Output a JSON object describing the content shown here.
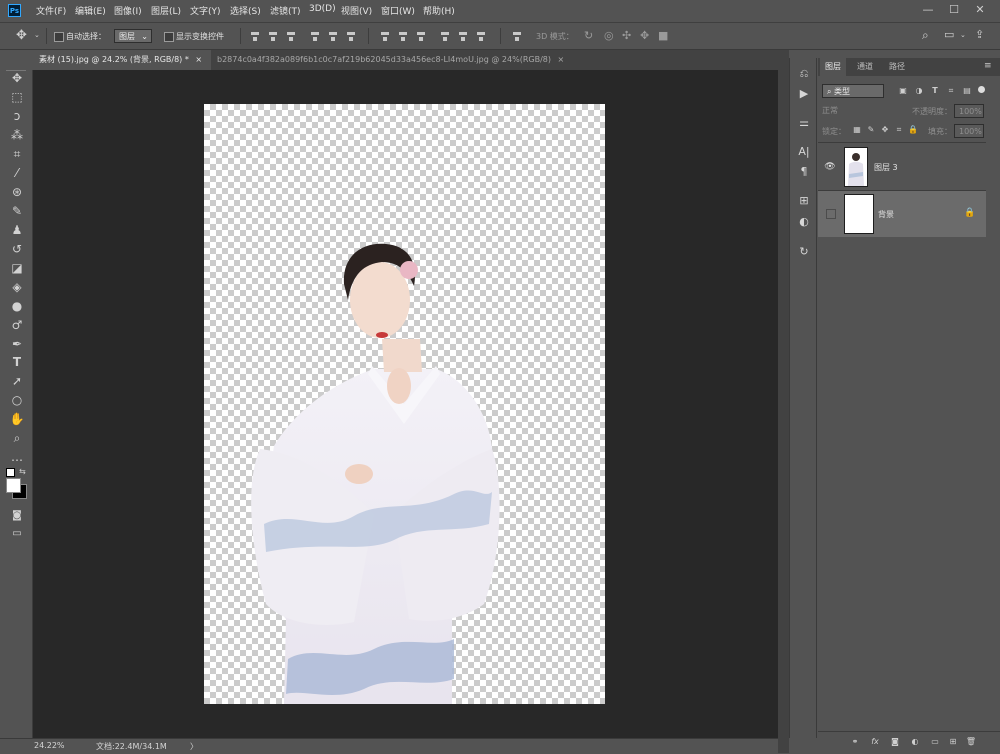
{
  "menubar": {
    "logo": "Ps",
    "items": [
      "文件(F)",
      "编辑(E)",
      "图像(I)",
      "图层(L)",
      "文字(Y)",
      "选择(S)",
      "滤镜(T)",
      "3D(D)",
      "视图(V)",
      "窗口(W)",
      "帮助(H)"
    ],
    "window_controls": [
      "—",
      "☐",
      "✕"
    ]
  },
  "options": {
    "auto_select_label": "自动选择：",
    "auto_select_value": "图层",
    "show_transform_label": "显示变换控件",
    "mode_3d_label": "3D 模式："
  },
  "tabs": [
    {
      "label": "素材 (15).jpg @ 24.2% (背景, RGB/8) *",
      "close": "×"
    },
    {
      "label": "b2874c0a4f382a089f6b1c0c7af219b62045d33a456ec8-LI4moU.jpg @ 24%(RGB/8)",
      "close": "×"
    }
  ],
  "status": {
    "zoom": "24.22%",
    "doc_info": "文档:22.4M/34.1M",
    "arrow": "〉"
  },
  "layers_panel": {
    "tabs": [
      "图层",
      "通道",
      "路径"
    ],
    "filter_kind": "类型",
    "blend_mode": "正常",
    "opacity_label": "不透明度：",
    "opacity_value": "100%",
    "lock_label": "锁定：",
    "fill_label": "填充：",
    "fill_value": "100%",
    "layers": [
      {
        "name": "图层 3",
        "visible": true,
        "selected": false
      },
      {
        "name": "背景",
        "visible": false,
        "selected": true,
        "locked": true
      }
    ]
  },
  "icons": {
    "accent": "#31a8ff",
    "tools": [
      "move-icon",
      "marquee-icon",
      "lasso-icon",
      "magic-wand-icon",
      "crop-icon",
      "eyedropper-icon",
      "healing-brush-icon",
      "brush-icon",
      "clone-stamp-icon",
      "history-brush-icon",
      "eraser-icon",
      "gradient-icon",
      "blur-icon",
      "dodge-icon",
      "pen-icon",
      "type-icon",
      "path-select-icon",
      "ellipse-icon",
      "hand-icon",
      "zoom-icon",
      "more-tools-icon"
    ]
  }
}
